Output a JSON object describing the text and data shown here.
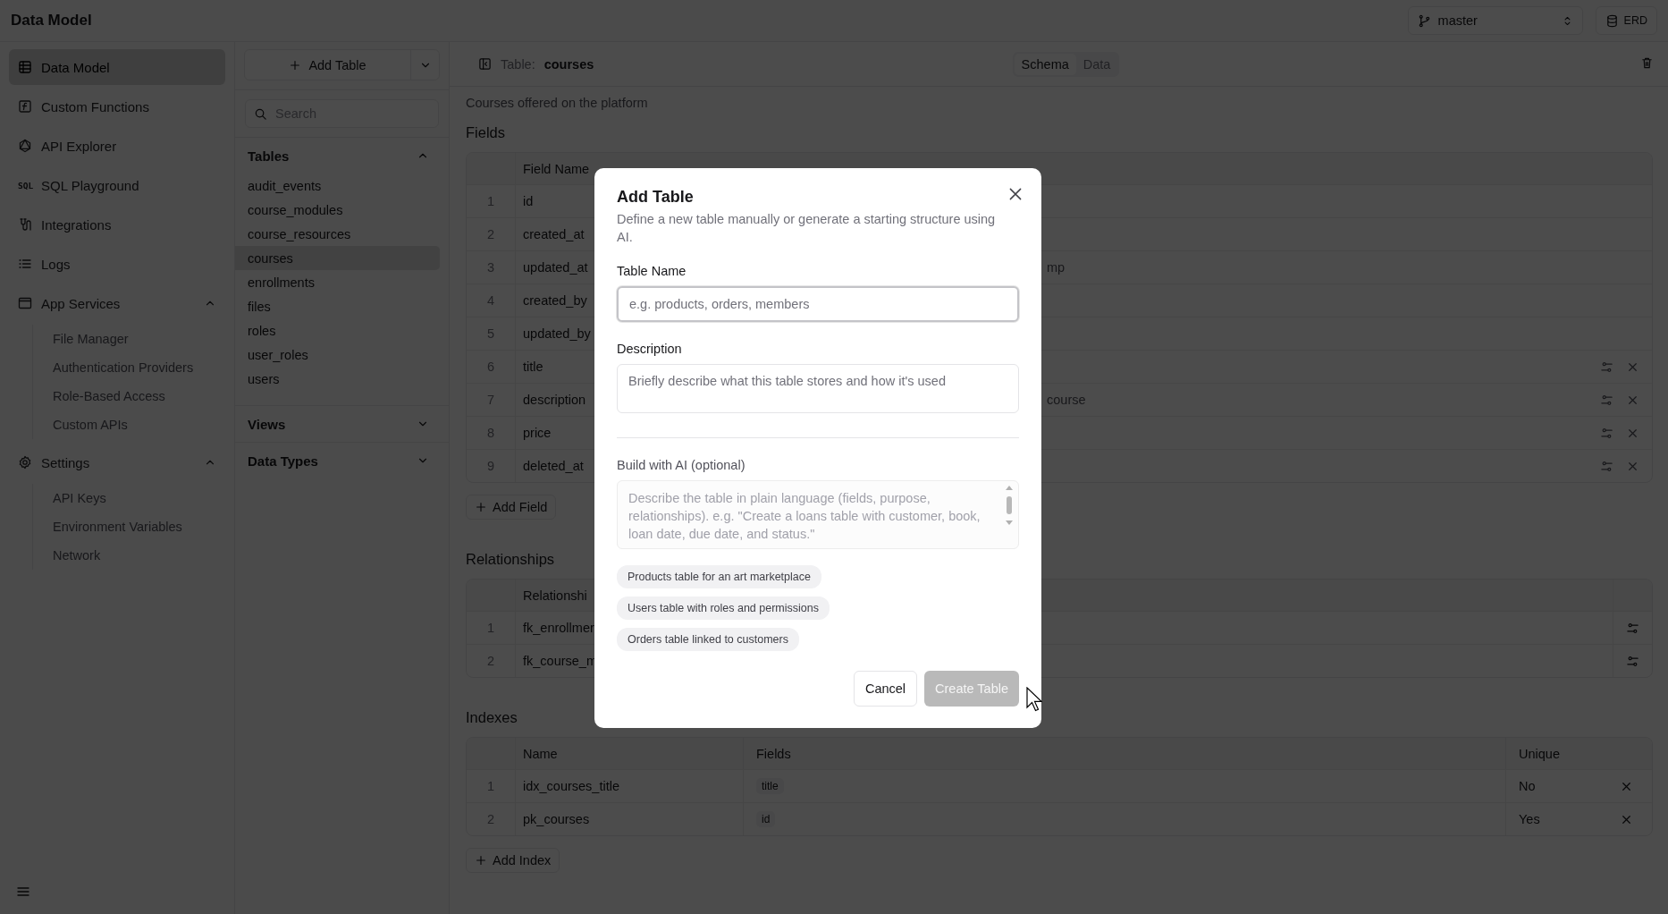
{
  "app": {
    "title": "Data Model"
  },
  "branch_selector": {
    "value": "master"
  },
  "erd_button": {
    "label": "ERD"
  },
  "sidebar": {
    "items": [
      {
        "kind": "table",
        "label": "Data Model",
        "selected": true
      },
      {
        "kind": "function",
        "label": "Custom Functions",
        "selected": false
      },
      {
        "kind": "api",
        "label": "API Explorer",
        "selected": false
      },
      {
        "kind": "sql",
        "icon_text": "SQL",
        "label": "SQL Playground",
        "selected": false
      },
      {
        "kind": "plug",
        "label": "Integrations",
        "selected": false
      },
      {
        "kind": "list",
        "label": "Logs",
        "selected": false
      },
      {
        "kind": "window",
        "label": "App Services",
        "selected": false,
        "expanded": true,
        "children": [
          {
            "label": "File Manager",
            "selected": false
          },
          {
            "label": "Authentication Providers",
            "selected": false
          },
          {
            "label": "Role-Based Access",
            "selected": false
          },
          {
            "label": "Custom APIs",
            "selected": false
          }
        ]
      },
      {
        "kind": "gear",
        "label": "Settings",
        "selected": false,
        "expanded": true,
        "children": [
          {
            "label": "API Keys",
            "selected": false
          },
          {
            "label": "Environment Variables",
            "selected": false
          },
          {
            "label": "Network",
            "selected": false
          }
        ]
      }
    ]
  },
  "table_panel": {
    "add_button": "Add Table",
    "search": {
      "placeholder": "Search"
    },
    "sections": [
      {
        "title": "Tables",
        "expanded": true,
        "items": [
          {
            "label": "audit_events",
            "selected": false
          },
          {
            "label": "course_modules",
            "selected": false
          },
          {
            "label": "course_resources",
            "selected": false
          },
          {
            "label": "courses",
            "selected": true
          },
          {
            "label": "enrollments",
            "selected": false
          },
          {
            "label": "files",
            "selected": false
          },
          {
            "label": "roles",
            "selected": false
          },
          {
            "label": "user_roles",
            "selected": false
          },
          {
            "label": "users",
            "selected": false
          }
        ]
      },
      {
        "title": "Views",
        "expanded": false
      },
      {
        "title": "Data Types",
        "expanded": false
      }
    ]
  },
  "header": {
    "label": "Table:",
    "name": "courses",
    "tabs": [
      {
        "label": "Schema",
        "selected": true
      },
      {
        "label": "Data",
        "selected": false
      }
    ]
  },
  "description": "Courses offered on the platform",
  "fields": {
    "title": "Fields",
    "columns": [
      "Field Name"
    ],
    "rows": [
      {
        "index": "1",
        "name": "id",
        "editable": false
      },
      {
        "index": "2",
        "name": "created_at",
        "editable": false
      },
      {
        "index": "3",
        "name": "updated_at",
        "column_4": "mp",
        "editable": false
      },
      {
        "index": "4",
        "name": "created_by",
        "editable": false
      },
      {
        "index": "5",
        "name": "updated_by",
        "editable": false
      },
      {
        "index": "6",
        "name": "title",
        "editable": true
      },
      {
        "index": "7",
        "name": "description",
        "column_4": "course",
        "editable": true
      },
      {
        "index": "8",
        "name": "price",
        "editable": true
      },
      {
        "index": "9",
        "name": "deleted_at",
        "editable": true
      }
    ],
    "add_button": "Add Field"
  },
  "relationships": {
    "title": "Relationships",
    "columns": [
      "Relationshi"
    ],
    "rows": [
      {
        "index": "1",
        "name": "fk_enrollmer"
      },
      {
        "index": "2",
        "name": "fk_course_m"
      }
    ]
  },
  "indexes": {
    "title": "Indexes",
    "columns": [
      "Name",
      "Fields",
      "Unique"
    ],
    "rows": [
      {
        "index": "1",
        "name": "idx_courses_title",
        "fields": [
          "title"
        ],
        "unique": "No"
      },
      {
        "index": "2",
        "name": "pk_courses",
        "fields": [
          "id"
        ],
        "unique": "Yes"
      }
    ],
    "add_button": "Add Index"
  },
  "dialog": {
    "title": "Add Table",
    "subtitle": "Define a new table manually or generate a starting structure using AI.",
    "name_field": {
      "label": "Table Name",
      "placeholder": "e.g. products, orders, members"
    },
    "description_field": {
      "label": "Description",
      "placeholder": "Briefly describe what this table stores and how it's used"
    },
    "ai_field": {
      "label": "Build with AI (optional)",
      "placeholder": "Describe the table in plain language (fields, purpose, relationships). e.g. \"Create a loans table with customer, book, loan date, due date, and status.\""
    },
    "suggestions": [
      "Products table for an art marketplace",
      "Users table with roles and permissions",
      "Orders table linked to customers"
    ],
    "buttons": [
      {
        "label": "Cancel",
        "kind": "secondary",
        "disabled": false
      },
      {
        "label": "Create Table",
        "kind": "primary",
        "disabled": true
      }
    ]
  }
}
